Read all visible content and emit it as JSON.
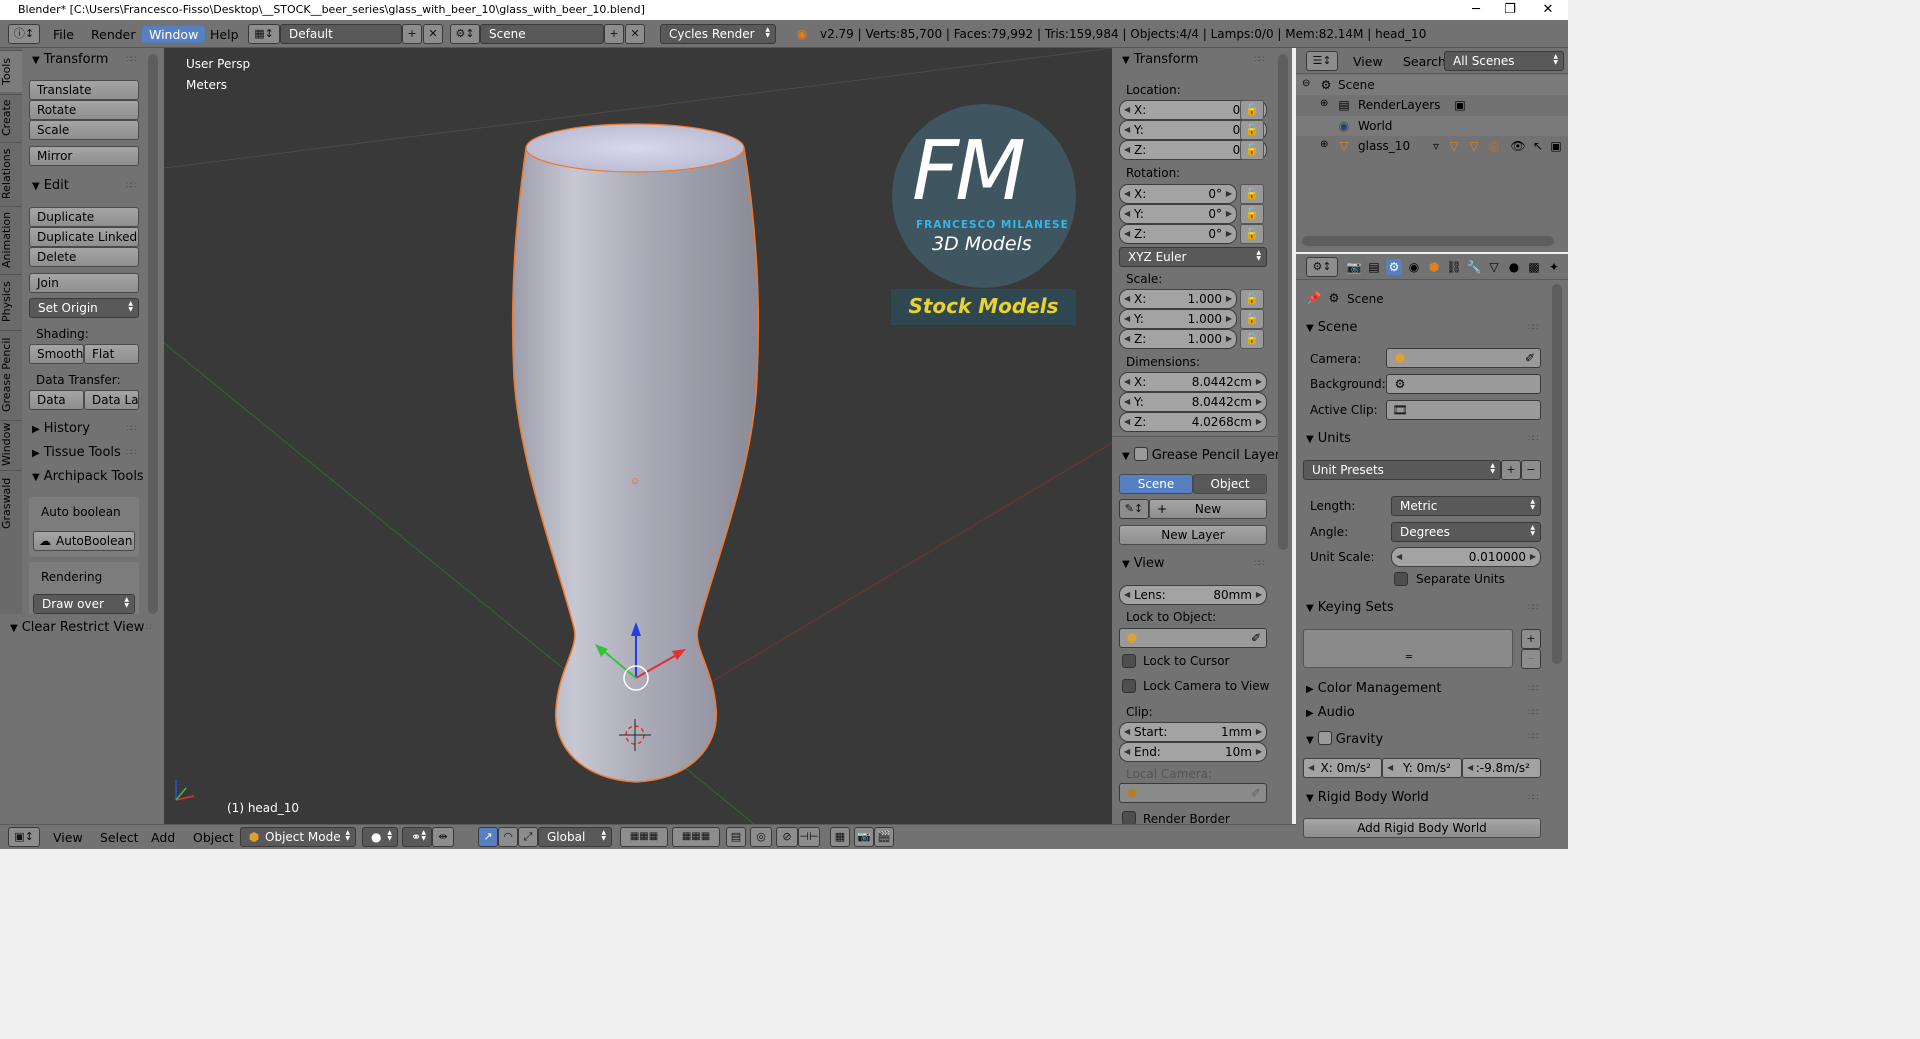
{
  "window": {
    "title": "Blender* [C:\\Users\\Francesco-Fisso\\Desktop\\__STOCK__beer_series\\glass_with_beer_10\\glass_with_beer_10.blend]",
    "minimize": "─",
    "maximize": "❐",
    "close": "✕"
  },
  "menubar": {
    "items": [
      "File",
      "Render",
      "Window",
      "Help"
    ],
    "layout_name": "Default",
    "scene_name": "Scene",
    "render_engine": "Cycles Render",
    "stats": "v2.79 | Verts:85,700 | Faces:79,992 | Tris:159,984 | Objects:4/4 | Lamps:0/0 | Mem:82.14M | head_10"
  },
  "left_tabs": [
    "Tools",
    "Create",
    "Relations",
    "Animation",
    "Physics",
    "Grease Pencil",
    "Window",
    "Graswald"
  ],
  "tools": {
    "transform_header": "Transform",
    "translate": "Translate",
    "rotate": "Rotate",
    "scale": "Scale",
    "mirror": "Mirror",
    "edit_header": "Edit",
    "duplicate": "Duplicate",
    "duplicate_linked": "Duplicate Linked",
    "delete": "Delete",
    "join": "Join",
    "set_origin": "Set Origin",
    "shading_label": "Shading:",
    "smooth": "Smooth",
    "flat": "Flat",
    "data_transfer_label": "Data Transfer:",
    "data": "Data",
    "data_la": "Data La",
    "history": "History",
    "tissue_tools": "Tissue Tools",
    "archipack_tools": "Archipack Tools",
    "auto_boolean_label": "Auto boolean",
    "autoboolean_btn": "AutoBoolean",
    "rendering_label": "Rendering",
    "draw_over": "Draw over",
    "clear_restrict_view": "Clear Restrict View"
  },
  "viewport": {
    "view_name": "User Persp",
    "units": "Meters",
    "object_label": "(1) head_10",
    "logo_fm": "FM",
    "logo_name": "FRANCESCO MILANESE",
    "logo_sub": "3D Models",
    "logo_stock": "Stock Models"
  },
  "n_panel": {
    "transform_header": "Transform",
    "location_label": "Location:",
    "loc_x": "0m",
    "loc_y": "0m",
    "loc_z": "0m",
    "rotation_label": "Rotation:",
    "rot_x": "0°",
    "rot_y": "0°",
    "rot_z": "0°",
    "rotation_mode": "XYZ Euler",
    "scale_label": "Scale:",
    "scale_x": "1.000",
    "scale_y": "1.000",
    "scale_z": "1.000",
    "dimensions_label": "Dimensions:",
    "dim_x": "8.0442cm",
    "dim_y": "8.0442cm",
    "dim_z": "4.0268cm",
    "gp_header": "Grease Pencil Layer",
    "gp_scene": "Scene",
    "gp_object": "Object",
    "gp_new": "New",
    "gp_new_layer": "New Layer",
    "view_header": "View",
    "lens_label": "Lens:",
    "lens_value": "80mm",
    "lock_to_object": "Lock to Object:",
    "lock_to_cursor": "Lock to Cursor",
    "lock_camera": "Lock Camera to View",
    "clip_label": "Clip:",
    "clip_start_label": "Start:",
    "clip_start": "1mm",
    "clip_end_label": "End:",
    "clip_end": "10m",
    "local_camera": "Local Camera:",
    "render_border": "Render Border",
    "axis_x": "X:",
    "axis_y": "Y:",
    "axis_z": "Z:"
  },
  "outliner": {
    "view": "View",
    "search": "Search",
    "filter": "All Scenes",
    "items": [
      "Scene",
      "RenderLayers",
      "World",
      "glass_10"
    ]
  },
  "properties": {
    "breadcrumb": "Scene",
    "scene_header": "Scene",
    "camera_label": "Camera:",
    "background_label": "Background:",
    "active_clip_label": "Active Clip:",
    "units_header": "Units",
    "unit_presets": "Unit Presets",
    "length_label": "Length:",
    "length_value": "Metric",
    "angle_label": "Angle:",
    "angle_value": "Degrees",
    "unit_scale_label": "Unit Scale:",
    "unit_scale_value": "0.010000",
    "separate_units": "Separate Units",
    "keying_sets_header": "Keying Sets",
    "color_management": "Color Management",
    "audio": "Audio",
    "gravity_header": "Gravity",
    "grav_x": "X:  0m/s²",
    "grav_y": "Y:  0m/s²",
    "grav_z": ":-9.8m/s²",
    "rigid_body_header": "Rigid Body World",
    "add_rigid_body": "Add Rigid Body World"
  },
  "bottombar": {
    "view": "View",
    "select": "Select",
    "add": "Add",
    "object": "Object",
    "mode": "Object Mode",
    "orientation": "Global"
  },
  "colors": {
    "accent": "#5680c2",
    "viewport_bg": "#393939",
    "panel_bg": "#727272",
    "selection_outline": "#f0782a"
  }
}
